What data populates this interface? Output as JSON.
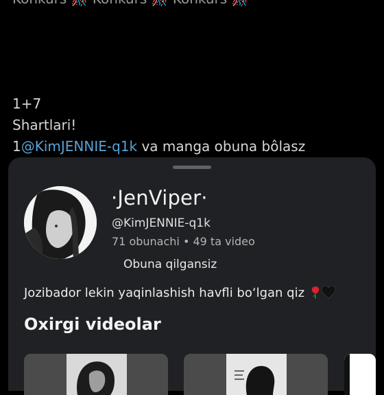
{
  "post": {
    "top_line": "Konkurs 🎊 Konkurs 🎊 Konkurs 🎊",
    "line1": "1+7",
    "line2": "Shartlari!",
    "line3_prefix": "1",
    "line3_mention": "@KimJENNIE-q1k",
    "line3_suffix": " va manga obuna bôlasz"
  },
  "channel": {
    "name": "·JenViper·",
    "handle": "@KimJENNIE-q1k",
    "stats": "71 obunachi • 49 ta video",
    "subscribe_label": "Obuna qilgansiz",
    "description": "Jozibador lekin yaqinlashish havfli bo‘lgan qiz",
    "avatar_icon": "profile-photo",
    "rose_icon": "rose-icon",
    "heart_icon": "black-heart-icon"
  },
  "recent_videos": {
    "title": "Oxirgi videolar",
    "items": [
      {
        "icon": "video-thumbnail"
      },
      {
        "icon": "video-thumbnail"
      },
      {
        "icon": "video-thumbnail"
      }
    ]
  },
  "colors": {
    "background": "#000000",
    "sheet": "#202124",
    "mention": "#5aa2d6"
  }
}
